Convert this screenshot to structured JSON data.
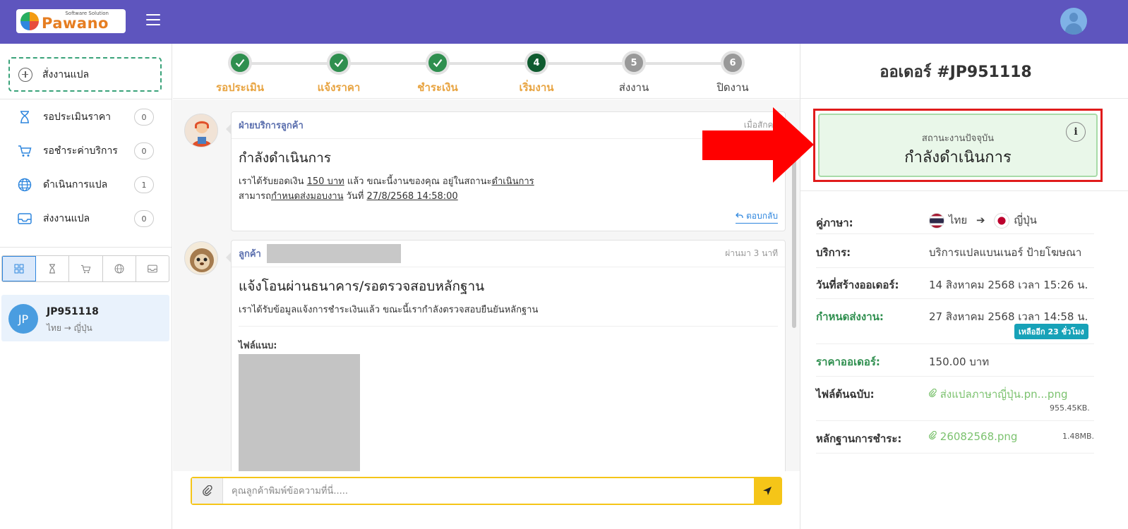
{
  "header": {
    "logo_sub": "Software Solution",
    "logo_name": "Pawano",
    "menu_icon": "hamburger-icon",
    "avatar_icon": "user-avatar-icon"
  },
  "sidebar": {
    "new_order_label": "สั่งงานแปล",
    "menu": [
      {
        "label": "รอประเมินราคา",
        "count": "0",
        "icon": "hourglass-icon"
      },
      {
        "label": "รอชำระค่าบริการ",
        "count": "0",
        "icon": "cart-icon"
      },
      {
        "label": "ดำเนินการแปล",
        "count": "1",
        "icon": "globe-icon"
      },
      {
        "label": "ส่งงานแปล",
        "count": "0",
        "icon": "inbox-icon"
      }
    ],
    "filter_tabs": [
      "grid-icon",
      "hourglass-icon",
      "cart-icon",
      "globe-icon",
      "inbox-icon"
    ],
    "order": {
      "avatar": "JP",
      "id": "JP951118",
      "lang": "ไทย → ญี่ปุ่น"
    }
  },
  "stepper": [
    {
      "label": "รอประเมิน",
      "state": "done",
      "num": "1"
    },
    {
      "label": "แจ้งราคา",
      "state": "done",
      "num": "2"
    },
    {
      "label": "ชำระเงิน",
      "state": "done",
      "num": "3"
    },
    {
      "label": "เริ่มงาน",
      "state": "current",
      "num": "4"
    },
    {
      "label": "ส่งงาน",
      "state": "pending",
      "num": "5"
    },
    {
      "label": "ปิดงาน",
      "state": "pending",
      "num": "6"
    }
  ],
  "messages": [
    {
      "sender": "ฝ่ายบริการลูกค้า",
      "time": "เมื่อสักครู่",
      "title": "กำลังดำเนินการ",
      "line1_a": "เราได้รับยอดเงิน ",
      "line1_amount": "150 บาท",
      "line1_b": " แล้ว ขณะนี้งานของคุณ อยู่ในสถานะ",
      "line1_status": "ดำเนินการ",
      "line2_a": "สามารถ",
      "line2_link": "กำหนดส่งมอบงาน",
      "line2_b": " วันที่ ",
      "line2_date": "27/8/2568 14:58:00",
      "reply": "ตอบกลับ"
    },
    {
      "sender": "ลูกค้า",
      "time": "ผ่านมา 3 นาที",
      "title": "แจ้งโอนผ่านธนาคาร/รอตรวจสอบหลักฐาน",
      "text": "เราได้รับข้อมูลแจ้งการชำระเงินแล้ว ขณะนี้เรากำลังตรวจสอบยืนยันหลักฐาน",
      "attach_label": "ไฟล์แนบ:"
    }
  ],
  "composer": {
    "placeholder": "คุณลูกค้าพิมพ์ข้อความที่นี่.....",
    "attach_icon": "paperclip-icon",
    "send_icon": "send-icon"
  },
  "order_panel": {
    "title": "ออเดอร์ #JP951118",
    "status_caption": "สถานะงานปัจจุบัน",
    "status_value": "กำลังดำเนินการ",
    "info_icon": "i",
    "rows": {
      "lang_label": "คู่ภาษา:",
      "lang_from": "ไทย",
      "lang_arrow": "➔",
      "lang_to": "ญี่ปุ่น",
      "service_label": "บริการ:",
      "service_value": "บริการแปลแบนเนอร์ ป้ายโฆษณา",
      "created_label": "วันที่สร้างออเดอร์:",
      "created_value": "14 สิงหาคม 2568 เวลา 15:26 น.",
      "deadline_label": "กำหนดส่งงาน:",
      "deadline_value": "27 สิงหาคม 2568 เวลา 14:58 น.",
      "deadline_badge": "เหลืออีก 23 ชั่วโมง",
      "price_label": "ราคาออเดอร์:",
      "price_value": "150.00 บาท",
      "file_label": "ไฟล์ต้นฉบับ:",
      "file_name": "ส่งแปลภาษาญี่ปุ่น.pn...png",
      "file_size": "955.45KB.",
      "proof_label": "หลักฐานการชำระ:",
      "proof_name": "26082568.png",
      "proof_size": "1.48MB."
    }
  },
  "colors": {
    "header_bg": "#5e55be",
    "accent_green": "#2f8f4f",
    "step_label": "#e8a441",
    "annotation_red": "#e01b1b",
    "composer_yellow": "#f5c518"
  }
}
